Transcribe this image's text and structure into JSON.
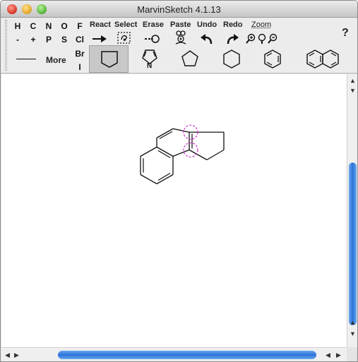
{
  "window": {
    "title": "MarvinSketch 4.1.13"
  },
  "elements": {
    "row1": [
      "H",
      "C",
      "N",
      "O",
      "F"
    ],
    "row2": [
      "-",
      "+",
      "P",
      "S",
      "Cl"
    ],
    "row3": [
      "Br",
      "I"
    ]
  },
  "tools": {
    "react": "React",
    "select": "Select",
    "erase": "Erase",
    "paste": "Paste",
    "undo": "Undo",
    "redo": "Redo",
    "zoom": "Zoom"
  },
  "help_label": "?",
  "more_label": "More",
  "shapes": [
    "cyclopentane",
    "pyrrole",
    "cyclopentane",
    "cyclohexane",
    "benzene",
    "naphthalene"
  ],
  "selected_shape": "cyclopentane",
  "icons": {
    "react": "right-arrow-icon",
    "select": "lasso-select-icon",
    "erase": "eraser-icon",
    "paste": "paste-icon",
    "undo": "undo-icon",
    "redo": "redo-icon",
    "zoom_in": "zoom-in-icon",
    "zoom_fit": "zoom-fit-icon",
    "zoom_out": "zoom-out-icon"
  },
  "colors": {
    "selection_highlight": "#cc33cc",
    "scroll_thumb": "#2c73d8"
  }
}
